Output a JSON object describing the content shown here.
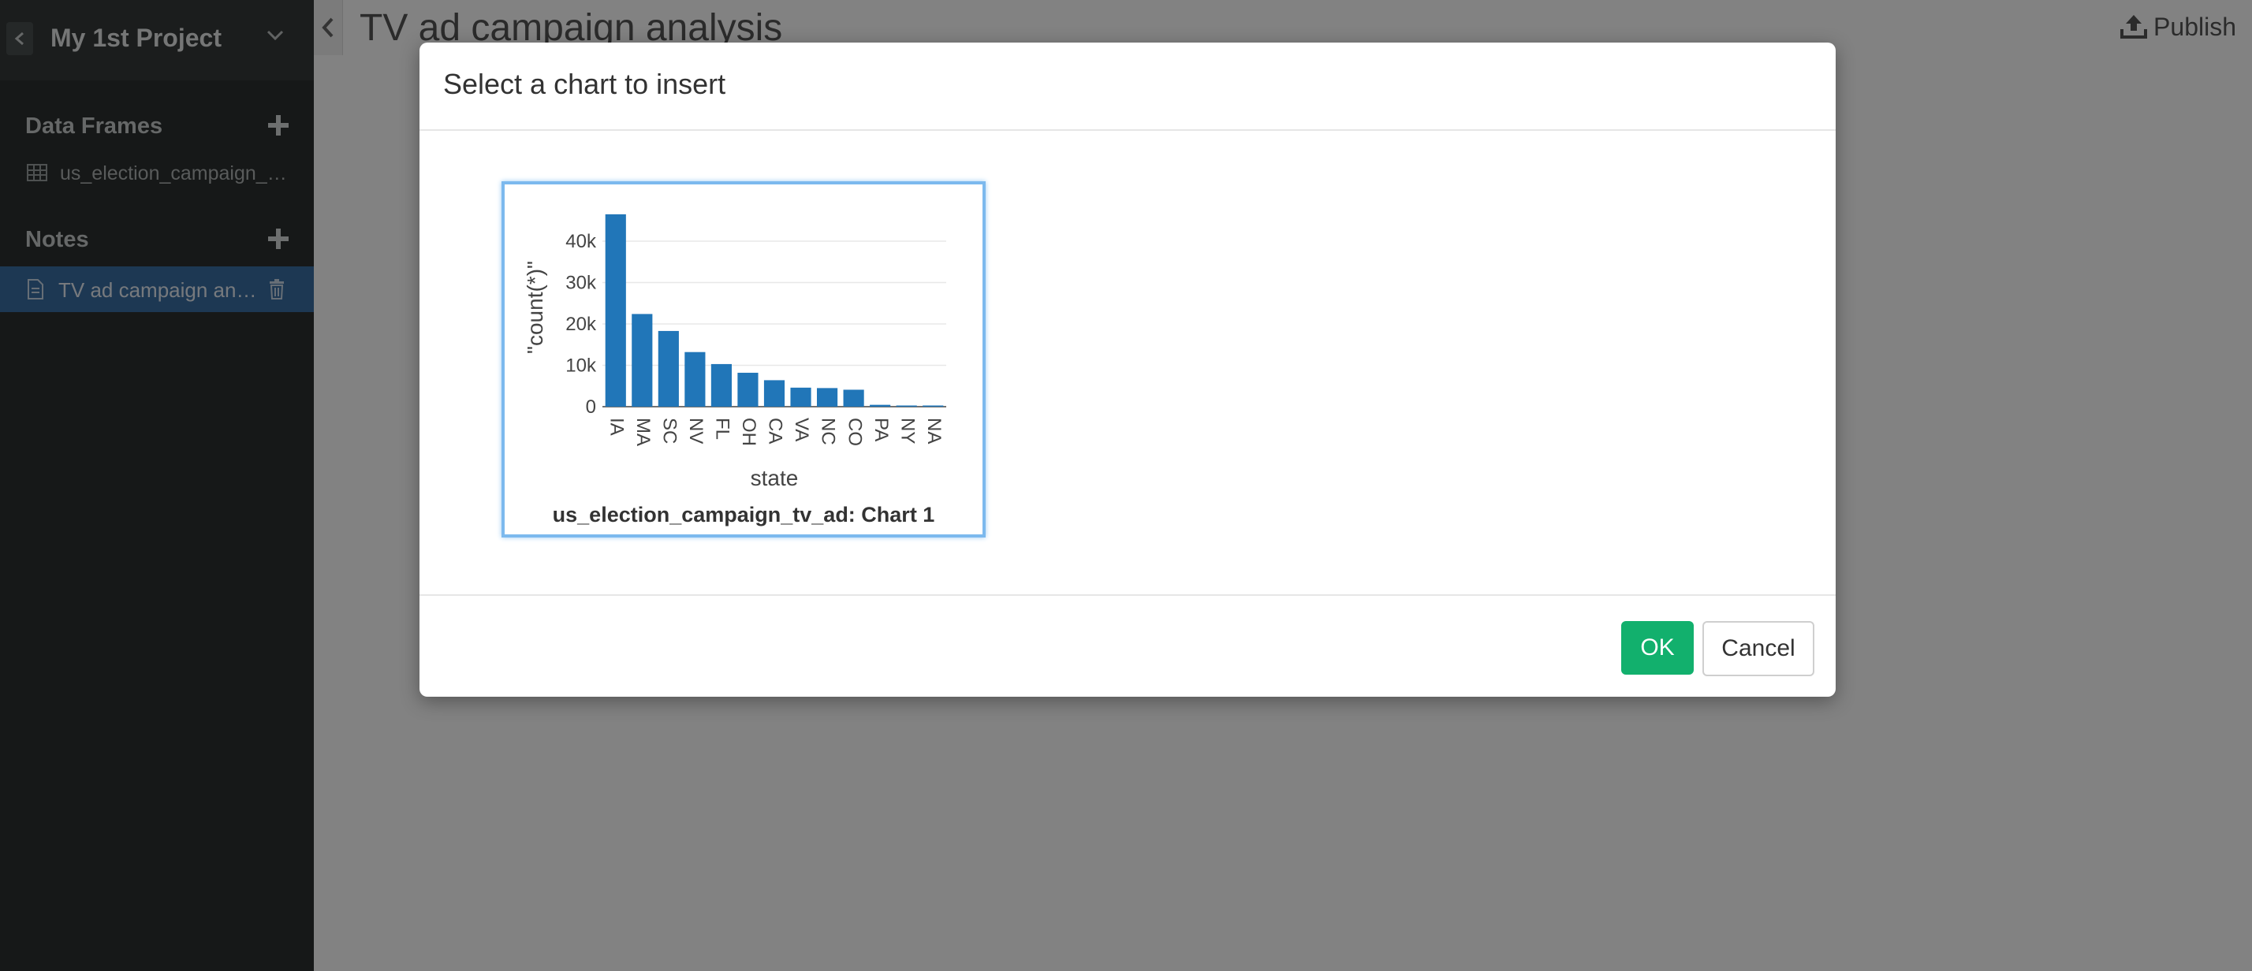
{
  "sidebar": {
    "project_title": "My 1st Project",
    "data_frames_label": "Data Frames",
    "data_frame_item": "us_election_campaign_tv_ad",
    "notes_label": "Notes",
    "note_item": "TV ad campaign analysis"
  },
  "main": {
    "note_title": "TV ad campaign analysis",
    "publish_label": "Publish"
  },
  "modal": {
    "title": "Select a chart to insert",
    "ok_label": "OK",
    "cancel_label": "Cancel",
    "chart_caption": "us_election_campaign_tv_ad: Chart 1"
  },
  "colors": {
    "bar": "#2176b8",
    "ok_button": "#12b06d",
    "selection_border": "#7cb9ee"
  },
  "chart_data": {
    "type": "bar",
    "categories": [
      "IA",
      "MA",
      "SC",
      "NV",
      "FL",
      "OH",
      "CA",
      "VA",
      "NC",
      "CO",
      "PA",
      "NY",
      "NA"
    ],
    "values": [
      46500,
      22400,
      18300,
      13200,
      10300,
      8200,
      6400,
      4600,
      4500,
      4100,
      450,
      250,
      150
    ],
    "xlabel": "state",
    "ylabel": "\"count(*)\"",
    "ylim": [
      0,
      48000
    ],
    "yticks": [
      0,
      10000,
      20000,
      30000,
      40000
    ],
    "ytick_labels": [
      "0",
      "10k",
      "20k",
      "30k",
      "40k"
    ],
    "grid": true
  }
}
